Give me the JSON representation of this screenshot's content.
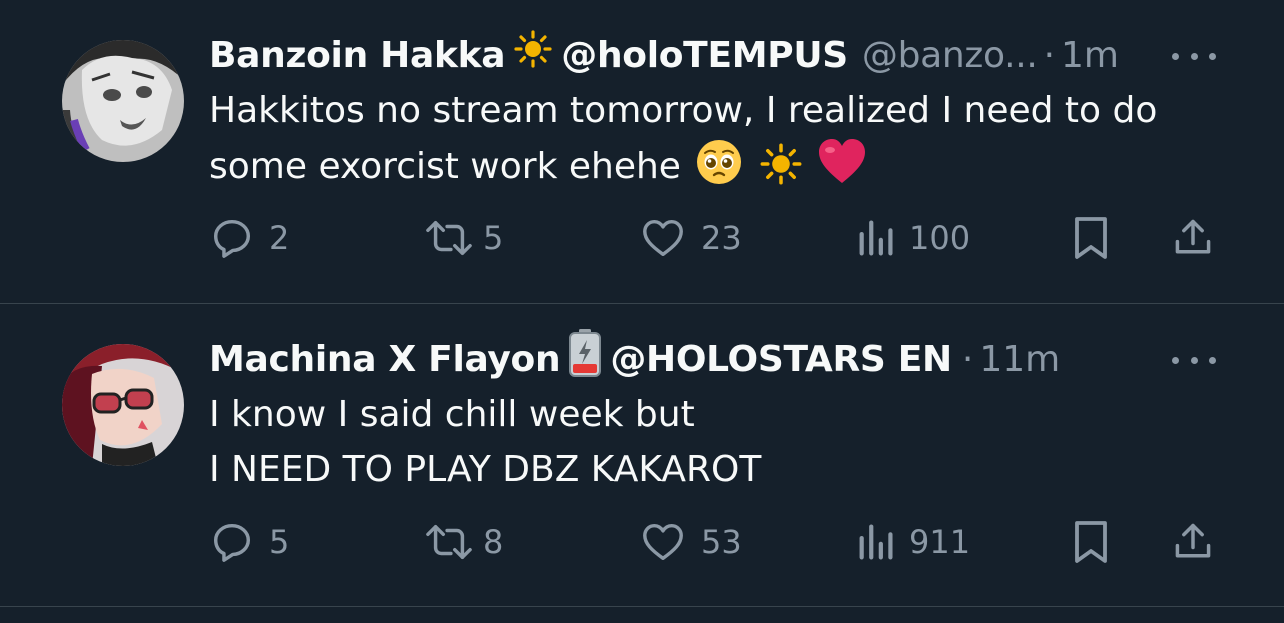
{
  "tweets": [
    {
      "name": "Banzoin Hakka",
      "affiliation": "@holoTEMPUS",
      "handle": "@banzo...",
      "separator": "·",
      "time": "1m",
      "lines": [
        "Hakkitos no stream tomorrow, I realized I need to do",
        "some exorcist work ehehe"
      ],
      "name_emoji": "sun-icon",
      "text_emojis": [
        "pleading-face-emoji",
        "sun-icon",
        "red-heart-emoji"
      ],
      "stats": {
        "replies": "2",
        "retweets": "5",
        "likes": "23",
        "views": "100"
      }
    },
    {
      "name": "Machina X Flayon",
      "affiliation": "@HOLOSTARS EN",
      "separator": "·",
      "time": "11m",
      "lines": [
        "I know I said chill week but",
        "I NEED TO PLAY DBZ KAKAROT"
      ],
      "name_emoji": "low-battery-icon",
      "stats": {
        "replies": "5",
        "retweets": "8",
        "likes": "53",
        "views": "911"
      }
    }
  ],
  "colors": {
    "background": "#15202b",
    "text_primary": "#f7f9f9",
    "text_secondary": "#8b98a5",
    "divider": "#38444d",
    "sun": "#f4b400",
    "heart": "#e0245e",
    "battery_red": "#e53935"
  }
}
